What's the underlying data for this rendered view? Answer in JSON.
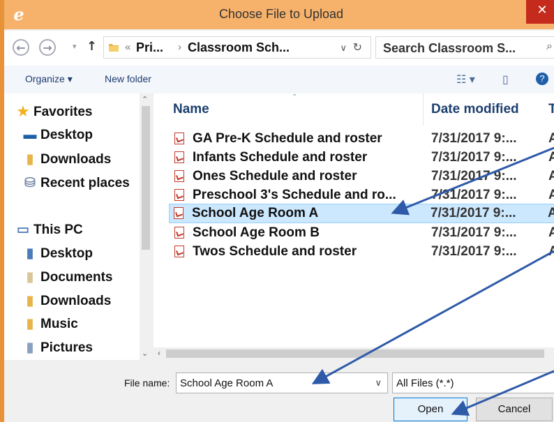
{
  "window": {
    "title": "Choose File to Upload",
    "close_glyph": "✕",
    "app_icon": "e"
  },
  "address": {
    "back_glyph": "←",
    "forward_glyph": "→",
    "history_glyph": "▾",
    "up_glyph": "↑",
    "path_prefix": "«",
    "path_segments": [
      "Pri...",
      "Classroom Sch..."
    ],
    "path_sep": "›",
    "dropdown_glyph": "∨",
    "refresh_glyph": "↻",
    "search_placeholder": "Search Classroom S...",
    "search_glyph": "⌕"
  },
  "toolbar": {
    "organize": "Organize ▾",
    "new_folder": "New folder",
    "view_glyph": "☷ ▾",
    "pane_glyph": "▯",
    "help_glyph": "?"
  },
  "nav": {
    "items": [
      {
        "label": "Favorites",
        "icon": "★"
      },
      {
        "label": "Desktop",
        "icon": "▬"
      },
      {
        "label": "Downloads",
        "icon": "▮"
      },
      {
        "label": "Recent places",
        "icon": "⛁"
      },
      {
        "label": "This PC",
        "icon": "▭"
      },
      {
        "label": "Desktop",
        "icon": "▮"
      },
      {
        "label": "Documents",
        "icon": "▮"
      },
      {
        "label": "Downloads",
        "icon": "▮"
      },
      {
        "label": "Music",
        "icon": "▮"
      },
      {
        "label": "Pictures",
        "icon": "▮"
      }
    ]
  },
  "files": {
    "columns": {
      "name": "Name",
      "date": "Date modified",
      "type": "Ty"
    },
    "rows": [
      {
        "name": "GA Pre-K Schedule and roster",
        "date": "7/31/2017 9:...",
        "type": "A"
      },
      {
        "name": "Infants Schedule and roster",
        "date": "7/31/2017 9:...",
        "type": "A"
      },
      {
        "name": "Ones Schedule and roster",
        "date": "7/31/2017 9:...",
        "type": "A"
      },
      {
        "name": "Preschool 3's Schedule and ro...",
        "date": "7/31/2017 9:...",
        "type": "A"
      },
      {
        "name": "School Age Room A",
        "date": "7/31/2017 9:...",
        "type": "A",
        "selected": true
      },
      {
        "name": "School Age Room B",
        "date": "7/31/2017 9:...",
        "type": "A"
      },
      {
        "name": "Twos Schedule and roster",
        "date": "7/31/2017 9:...",
        "type": "A"
      }
    ]
  },
  "bottom": {
    "file_name_label": "File name:",
    "file_name_value": "School Age Room A",
    "file_type_value": "All Files (*.*)",
    "open_label": "Open",
    "cancel_label": "Cancel"
  },
  "colors": {
    "titlebar": "#f6b26b",
    "accent_border": "#e8923a",
    "selection": "#cce8ff",
    "annotation_arrow": "#2e5aa8"
  }
}
